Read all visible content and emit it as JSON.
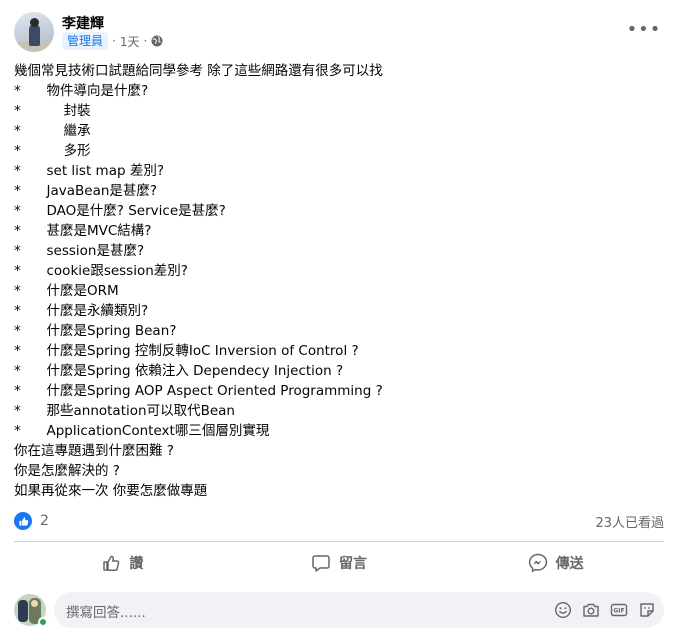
{
  "post": {
    "author": "李建輝",
    "badge": "管理員",
    "time": "1天",
    "lines": [
      "幾個常見技術口試題給同學參考 除了這些網路還有很多可以找",
      "*      物件導向是什麼?",
      "*          封裝",
      "*          繼承",
      "*          多形",
      "*      set list map 差別?",
      "*      JavaBean是甚麼?",
      "*      DAO是什麼? Service是甚麼?",
      "*      甚麼是MVC結構?",
      "*      session是甚麼?",
      "*      cookie跟session差別?",
      "*      什麼是ORM",
      "*      什麼是永續類別?",
      "*      什麼是Spring Bean?",
      "*      什麼是Spring 控制反轉IoC Inversion of Control ?",
      "*      什麼是Spring 依賴注入 Dependecy Injection ?",
      "*      什麼是Spring AOP Aspect Oriented Programming ?",
      "*      那些annotation可以取代Bean",
      "*      ApplicationContext哪三個層別實現",
      "你在這專題遇到什麼困難 ?",
      "你是怎麼解決的 ?",
      "如果再從來一次 你要怎麼做專題"
    ]
  },
  "reactions": {
    "count": "2",
    "seen": "23人已看過"
  },
  "actions": {
    "like": "讚",
    "comment": "留言",
    "share": "傳送"
  },
  "comment": {
    "placeholder": "撰寫回答......"
  },
  "icons": {
    "globe": "globe-icon",
    "more": "more-icon",
    "like": "thumbs-up-icon",
    "comment": "speech-bubble-icon",
    "share": "messenger-icon",
    "emoji": "smiley-icon",
    "camera": "camera-icon",
    "gif": "gif-icon",
    "sticker": "sticker-icon"
  },
  "colors": {
    "accent": "#1877f2",
    "badge_bg": "#e7f3ff",
    "badge_text": "#1b74e4",
    "muted": "#65676b",
    "online": "#31a24c"
  }
}
